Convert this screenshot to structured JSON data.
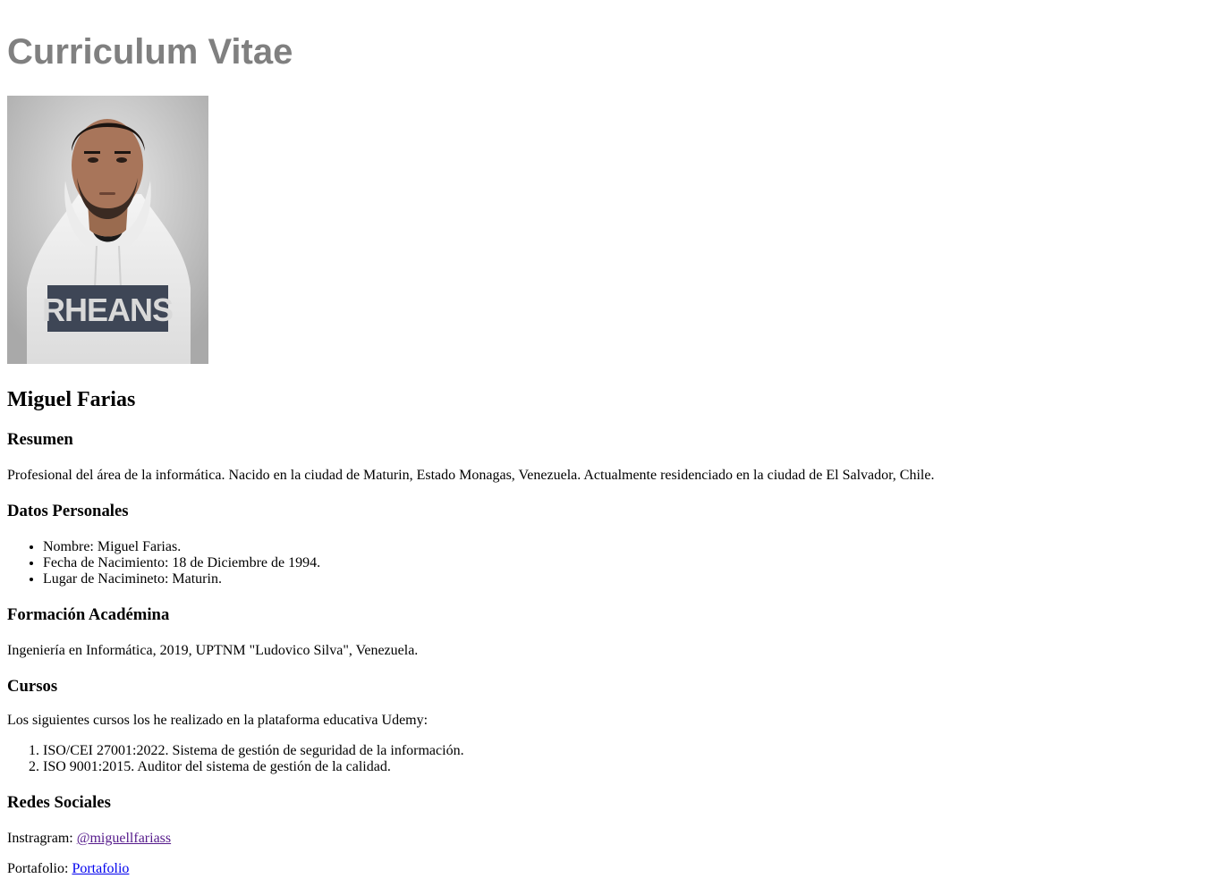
{
  "header": {
    "title": "Curriculum Vitae",
    "title_color": "#808080"
  },
  "photo": {
    "icon": "portrait-photo",
    "shirt_text": "RHEANS"
  },
  "profile": {
    "name": "Miguel Farias"
  },
  "resumen": {
    "heading": "Resumen",
    "text": "Profesional del área de la informática. Nacido en la ciudad de Maturin, Estado Monagas, Venezuela. Actualmente residenciado en la ciudad de El Salvador, Chile."
  },
  "datos": {
    "heading": "Datos Personales",
    "items": [
      "Nombre: Miguel Farias.",
      "Fecha de Nacimiento: 18 de Diciembre de 1994.",
      "Lugar de Nacimineto: Maturin."
    ]
  },
  "formacion": {
    "heading": "Formación Académina",
    "text": "Ingeniería en Informática, 2019, UPTNM \"Ludovico Silva\", Venezuela."
  },
  "cursos": {
    "heading": "Cursos",
    "intro": "Los siguientes cursos los he realizado en la plataforma educativa Udemy:",
    "items": [
      "ISO/CEI 27001:2022. Sistema de gestión de seguridad de la información.",
      "ISO 9001:2015. Auditor del sistema de gestión de la calidad."
    ]
  },
  "redes": {
    "heading": "Redes Sociales",
    "instagram_label": "Instragram: ",
    "instagram_link": "@miguellfariass",
    "portfolio_label": "Portafolio: ",
    "portfolio_link": "Portafolio"
  },
  "colors": {
    "link_visited": "#551a8b",
    "link_unvisited": "#0000ee"
  }
}
